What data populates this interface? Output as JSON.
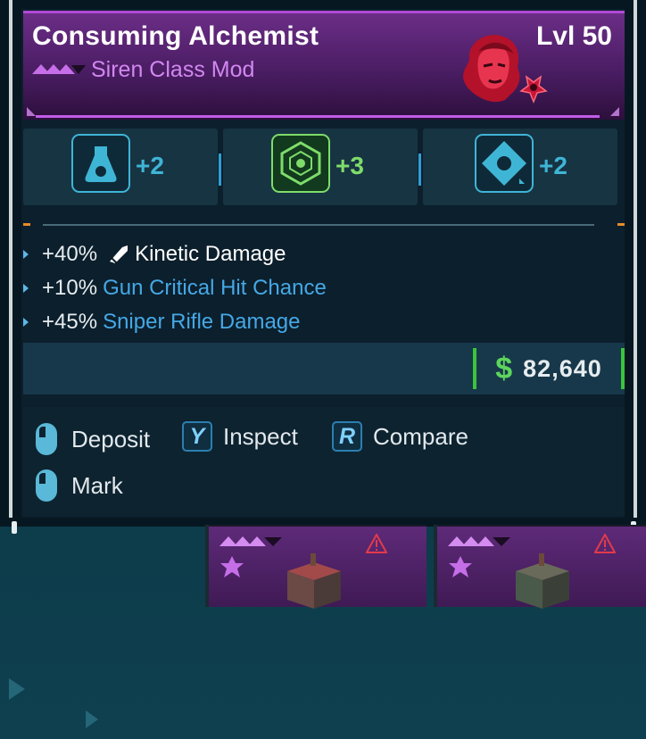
{
  "item": {
    "name": "Consuming Alchemist",
    "level": "Lvl 50",
    "type": "Siren Class Mod"
  },
  "skills": [
    {
      "value": "+2",
      "icon": "flask-icon",
      "color": "#3fb5d6"
    },
    {
      "value": "+3",
      "icon": "web-icon",
      "color": "#7edc6a"
    },
    {
      "value": "+2",
      "icon": "diamond-swirl-icon",
      "color": "#3fb5d6"
    }
  ],
  "stats": [
    {
      "pct": "+40%",
      "text": "Kinetic Damage"
    },
    {
      "pct": "+10%",
      "text": "Gun Critical Hit Chance"
    },
    {
      "pct": "+45%",
      "text": "Sniper Rifle Damage"
    }
  ],
  "price": {
    "symbol": "$",
    "value": "82,640"
  },
  "actions": {
    "deposit": "Deposit",
    "inspect_key": "Y",
    "inspect": "Inspect",
    "compare_key": "R",
    "compare": "Compare",
    "mark": "Mark"
  },
  "colors": {
    "rarity": "#b04ad6",
    "money": "#3cc43c",
    "stat_blue": "#45a8e6"
  }
}
